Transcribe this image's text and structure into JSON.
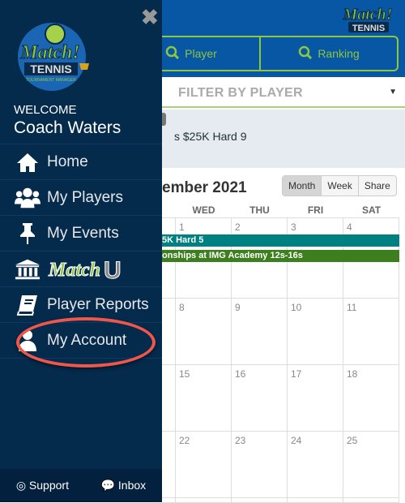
{
  "header": {
    "buttons": [
      {
        "label": "Player",
        "icon": "search-icon"
      },
      {
        "label": "Ranking",
        "icon": "search-icon"
      }
    ],
    "logo_text": "Match! TENNIS"
  },
  "filter": {
    "label": "FILTER BY PLAYER"
  },
  "info": {
    "text": "s $25K Hard 9"
  },
  "calendar": {
    "title": "ember 2021",
    "views": [
      "Month",
      "Week",
      "Share"
    ],
    "days": [
      "WED",
      "THU",
      "FRI",
      "SAT"
    ],
    "rows": [
      [
        "1",
        "2",
        "3",
        "4"
      ],
      [
        "8",
        "9",
        "10",
        "11"
      ],
      [
        "15",
        "16",
        "17",
        "18"
      ],
      [
        "22",
        "23",
        "24",
        "25"
      ]
    ],
    "events": [
      {
        "label": "5K Hard 5",
        "color": "#008080"
      },
      {
        "label": "onships at IMG Academy 12s-16s",
        "color": "#3d7f1f"
      }
    ]
  },
  "sidebar": {
    "welcome": "WELCOME",
    "name": "Coach Waters",
    "logo_text": "Match! TENNIS TOURNAMENT MANAGER",
    "items": [
      {
        "label": "Home",
        "icon": "home-icon"
      },
      {
        "label": "My Players",
        "icon": "users-icon"
      },
      {
        "label": "My Events",
        "icon": "pin-icon"
      },
      {
        "label": "MatchU",
        "icon": "bank-icon"
      },
      {
        "label": "Player Reports",
        "icon": "book-icon"
      },
      {
        "label": "My Account",
        "icon": "user-icon"
      }
    ],
    "footer": {
      "support": "Support",
      "inbox": "Inbox"
    }
  },
  "colors": {
    "sidebar": "#042a4c",
    "header": "#0857a5",
    "accent": "#8dc63f",
    "highlight": "#f0564a"
  }
}
